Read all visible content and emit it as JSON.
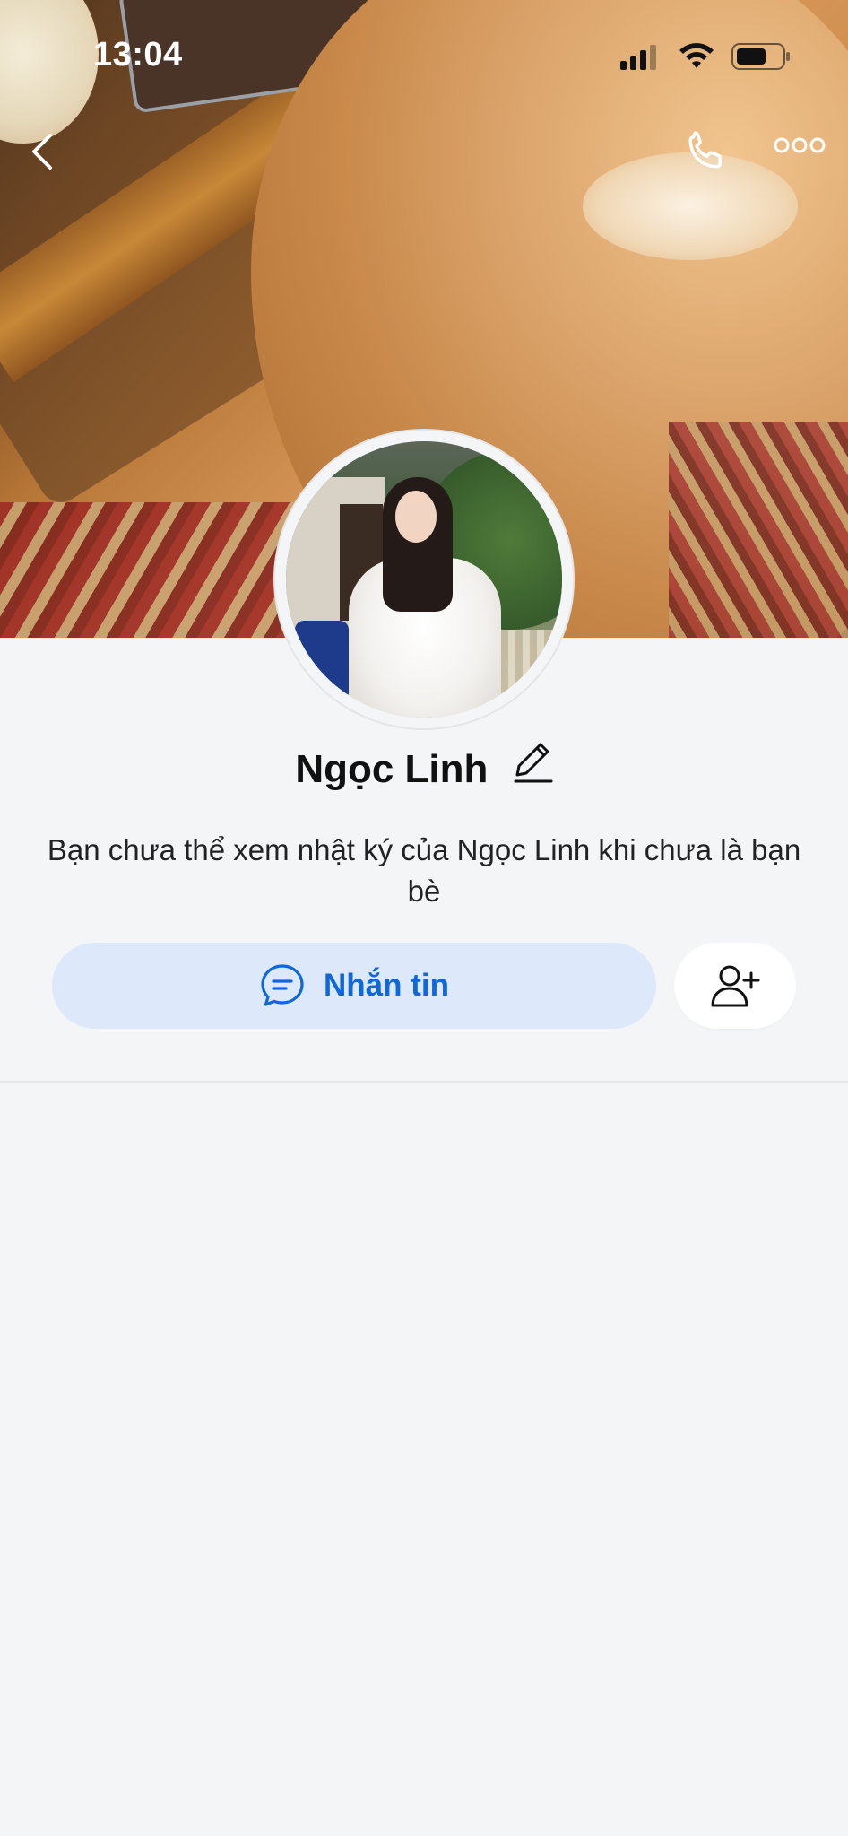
{
  "status_bar": {
    "time": "13:04"
  },
  "profile": {
    "name": "Ngọc Linh",
    "notice": "Bạn chưa thể xem nhật ký của Ngọc Linh khi chưa là bạn bè"
  },
  "actions": {
    "message_label": "Nhắn tin"
  },
  "colors": {
    "accent": "#1068d8",
    "message_button_bg": "#dde9fb",
    "page_bg": "#f4f5f7"
  },
  "icons": {
    "back": "chevron-left-icon",
    "call": "phone-icon",
    "more": "more-horizontal-icon",
    "edit": "pencil-icon",
    "message": "chat-bubble-icon",
    "add_friend": "add-user-icon"
  }
}
